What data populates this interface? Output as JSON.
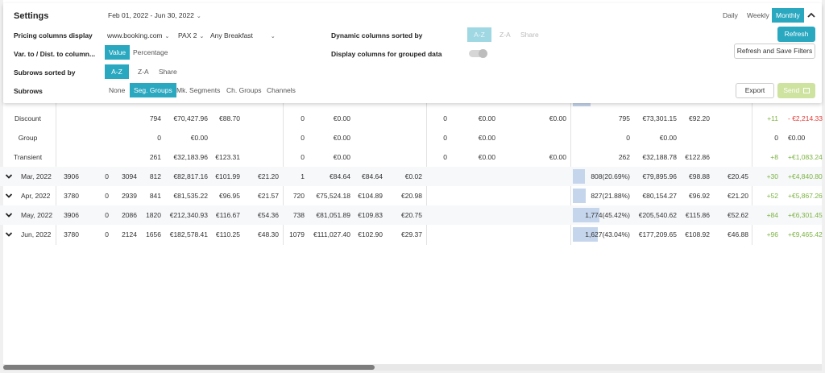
{
  "settings": {
    "title": "Settings",
    "date_range": "Feb 01, 2022 - Jun 30, 2022",
    "pricing_label": "Pricing columns display",
    "pricing_source": "www.booking.com",
    "pricing_pax": "PAX 2",
    "pricing_board": "Any Breakfast",
    "var_label": "Var. to / Dist. to column...",
    "var_options": [
      "Value",
      "Percentage"
    ],
    "subrows_sorted_label": "Subrows sorted by",
    "subrows_sorted_options": [
      "A-Z",
      "Z-A",
      "Share"
    ],
    "subrows_label": "Subrows",
    "subrows_options": [
      "None",
      "Seg. Groups",
      "Mk. Segments",
      "Ch. Groups",
      "Channels"
    ],
    "dynamic_label": "Dynamic columns sorted by",
    "dynamic_options": [
      "A-Z",
      "Z-A",
      "Share"
    ],
    "grouped_label": "Display columns for grouped data",
    "period_options": [
      "Daily",
      "Weekly",
      "Monthly"
    ],
    "refresh": "Refresh",
    "refresh_save": "Refresh and Save Filters",
    "export": "Export",
    "send": "Send"
  },
  "colors": {
    "accent": "#2aa8c0",
    "positive": "#7cb342",
    "negative": "#e53935",
    "bar": "#c5d5ec"
  },
  "subrows": [
    {
      "name": "Discount",
      "c3": "794",
      "c4": "€70,427.96",
      "c5": "€88.70",
      "c7": "0",
      "c8": "€0.00",
      "c11": "0",
      "c12": "€0.00",
      "c13": "€0.00",
      "c14": "795",
      "c15": "€73,301.15",
      "c16": "€92.20",
      "c18": "+11",
      "c19": "- €2,214.33",
      "c19neg": true
    },
    {
      "name": "Group",
      "c3": "0",
      "c4": "€0.00",
      "c5": "",
      "c7": "0",
      "c8": "€0.00",
      "c11": "0",
      "c12": "€0.00",
      "c13": "",
      "c14": "0",
      "c15": "€0.00",
      "c16": "",
      "c18": "0",
      "c19": "€0.00",
      "c19neg": false
    },
    {
      "name": "Transient",
      "c3": "261",
      "c4": "€32,183.96",
      "c5": "€123.31",
      "c7": "0",
      "c8": "€0.00",
      "c11": "0",
      "c12": "€0.00",
      "c13": "€0.00",
      "c14": "262",
      "c15": "€32,188.78",
      "c16": "€122.86",
      "c18": "+8",
      "c19": "+€1,083.24",
      "c19neg": false
    }
  ],
  "months": [
    {
      "name": "Mar, 2022",
      "a": "3906",
      "b": "0",
      "c": "3094",
      "d": "812",
      "e": "€82,817.16",
      "f": "€101.99",
      "g": "€21.20",
      "h": "1",
      "i": "€84.64",
      "j": "€84.64",
      "k": "€0.02",
      "otb": "808(20.69%)",
      "share": 0.2069,
      "l": "€79,895.96",
      "m": "€98.88",
      "n": "€20.45",
      "p": "+30",
      "q": "+€4,840.80"
    },
    {
      "name": "Apr, 2022",
      "a": "3780",
      "b": "0",
      "c": "2939",
      "d": "841",
      "e": "€81,535.22",
      "f": "€96.95",
      "g": "€21.57",
      "h": "720",
      "i": "€75,524.18",
      "j": "€104.89",
      "k": "€20.98",
      "otb": "827(21.88%)",
      "share": 0.2188,
      "l": "€80,154.27",
      "m": "€96.92",
      "n": "€21.20",
      "p": "+52",
      "q": "+€5,867.26"
    },
    {
      "name": "May, 2022",
      "a": "3906",
      "b": "0",
      "c": "2086",
      "d": "1820",
      "e": "€212,340.93",
      "f": "€116.67",
      "g": "€54.36",
      "h": "738",
      "i": "€81,051.89",
      "j": "€109.83",
      "k": "€20.75",
      "otb": "1,774(45.42%)",
      "share": 0.4542,
      "l": "€205,540.62",
      "m": "€115.86",
      "n": "€52.62",
      "p": "+84",
      "q": "+€6,301.45"
    },
    {
      "name": "Jun, 2022",
      "a": "3780",
      "b": "0",
      "c": "2124",
      "d": "1656",
      "e": "€182,578.41",
      "f": "€110.25",
      "g": "€48.30",
      "h": "1079",
      "i": "€111,027.40",
      "j": "€102.90",
      "k": "€29.37",
      "otb": "1,627(43.04%)",
      "share": 0.4304,
      "l": "€177,209.65",
      "m": "€108.92",
      "n": "€46.88",
      "p": "+96",
      "q": "+€9,465.42"
    }
  ]
}
